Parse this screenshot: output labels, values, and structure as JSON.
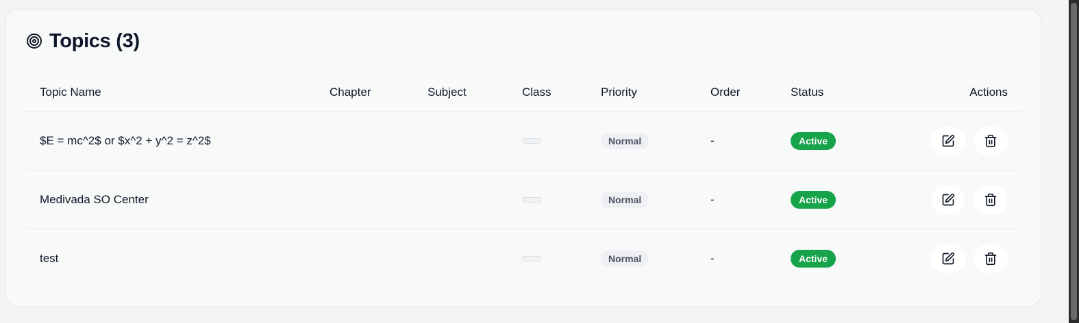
{
  "card": {
    "title": "Topics (3)",
    "icon": "target-icon"
  },
  "table": {
    "headers": {
      "topic_name": "Topic Name",
      "chapter": "Chapter",
      "subject": "Subject",
      "class": "Class",
      "priority": "Priority",
      "order": "Order",
      "status": "Status",
      "actions": "Actions"
    },
    "rows": [
      {
        "topic_name": "$E = mc^2$ or $x^2 + y^2 = z^2$",
        "chapter": "",
        "subject": "",
        "class": "",
        "priority": "Normal",
        "order": "-",
        "status": "Active"
      },
      {
        "topic_name": "Medivada SO Center",
        "chapter": "",
        "subject": "",
        "class": "",
        "priority": "Normal",
        "order": "-",
        "status": "Active"
      },
      {
        "topic_name": "test",
        "chapter": "",
        "subject": "",
        "class": "",
        "priority": "Normal",
        "order": "-",
        "status": "Active"
      }
    ]
  },
  "icons": {
    "edit": "edit-icon",
    "delete": "trash-icon"
  },
  "colors": {
    "status_active": "#16a34a",
    "priority_bg": "#eef0f3",
    "card_bg": "#f8f9f9"
  }
}
